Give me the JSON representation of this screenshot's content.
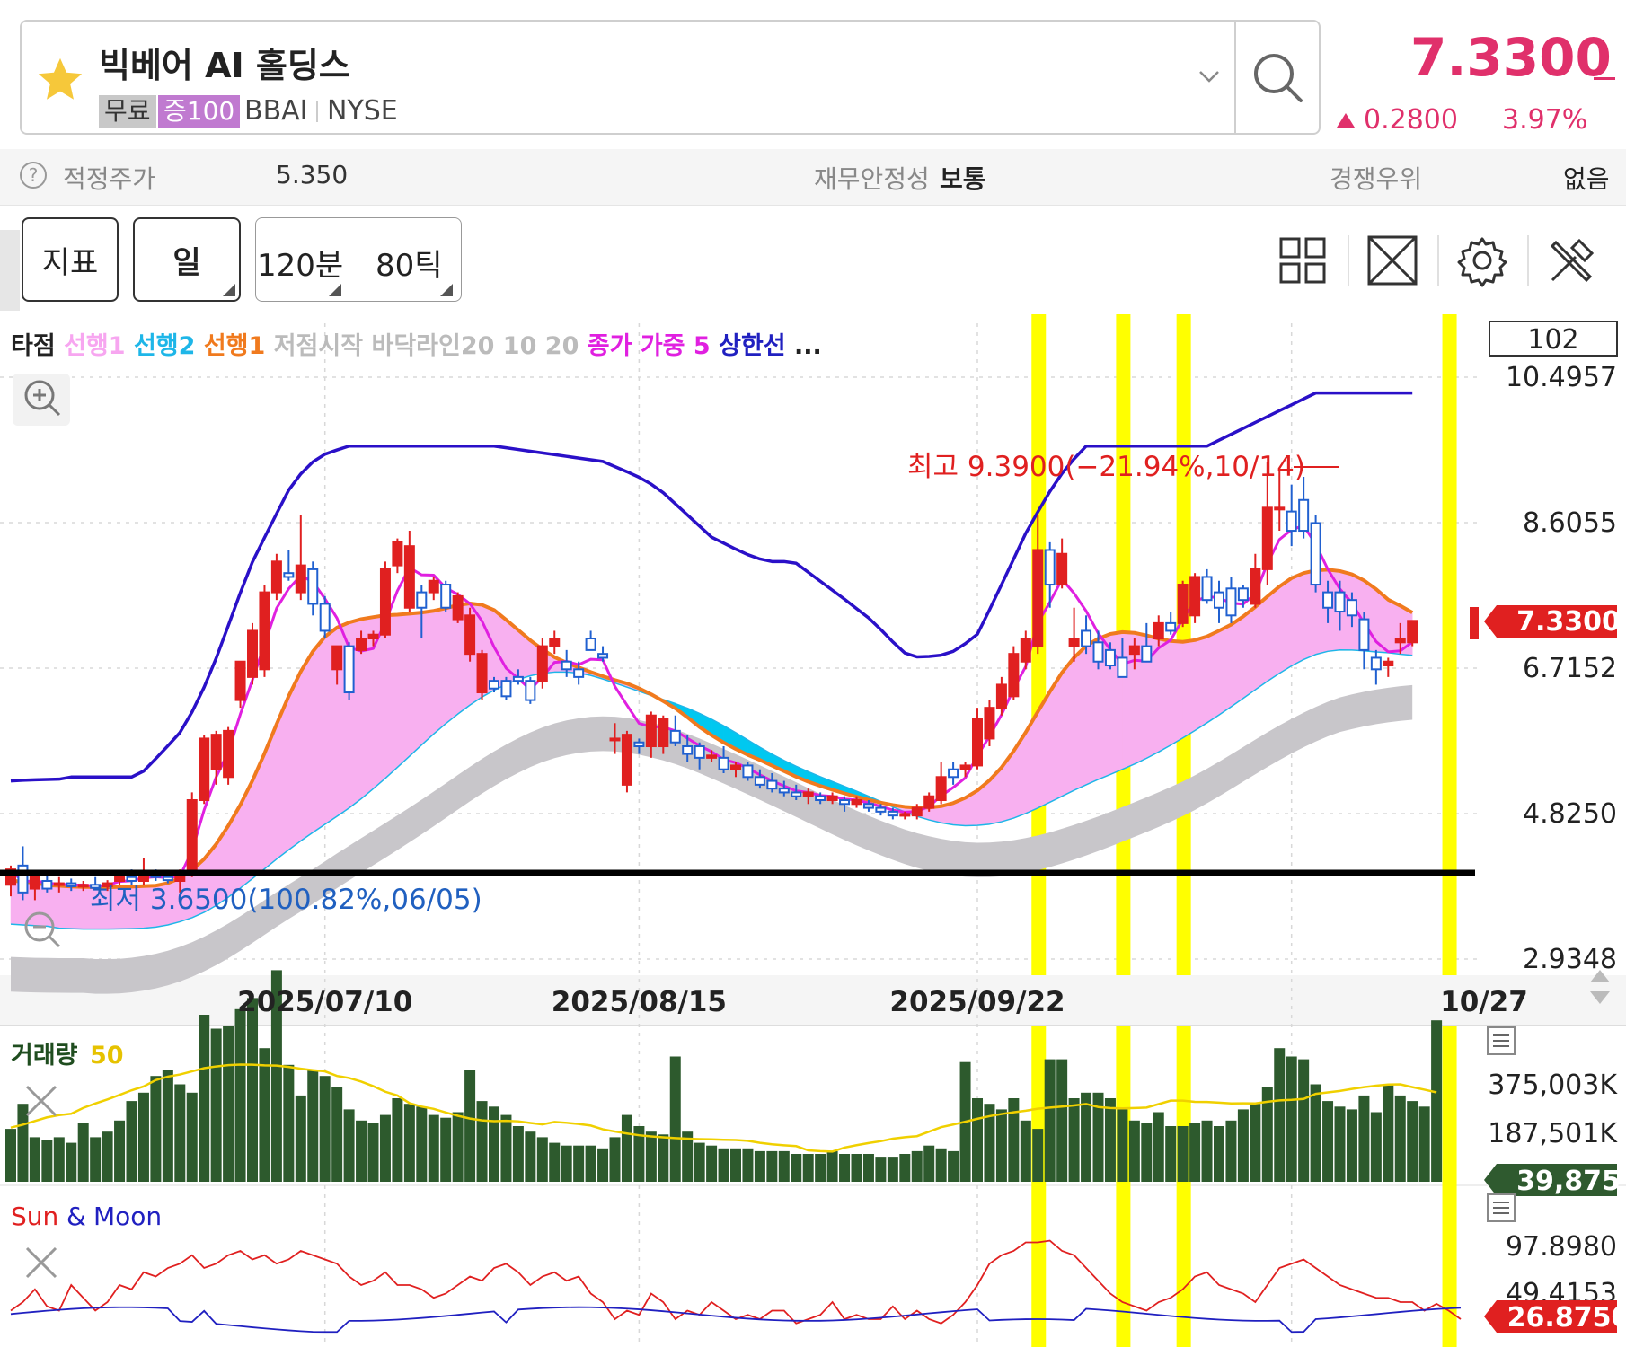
{
  "header": {
    "stock_name": "빅베어 AI 홀딩스",
    "tag_free": "무료",
    "tag_margin": "증100",
    "ticker": "BBAI",
    "exchange": "NYSE",
    "price": "7.3300",
    "change": "0.2800",
    "change_pct": "3.97%",
    "up_color": "#e0306b"
  },
  "info_bar": {
    "fair_price_label": "적정주가",
    "fair_price_value": "5.350",
    "stability_label": "재무안정성",
    "stability_value": "보통",
    "competitive_label": "경쟁우위",
    "competitive_value": "없음"
  },
  "toolbar": {
    "indicator_label": "지표",
    "day_label": "일",
    "min120_label": "120분",
    "tick80_label": "80틱",
    "icons": [
      "layout-grid-icon",
      "fullscreen-icon",
      "settings-gear-icon",
      "tools-icon"
    ]
  },
  "legend": {
    "items": [
      {
        "text": "타점",
        "color": "#222222"
      },
      {
        "text": "선행1",
        "color": "#f7a6f0"
      },
      {
        "text": "선행2",
        "color": "#1eb6e8"
      },
      {
        "text": "선행1",
        "color": "#f07a1e"
      },
      {
        "text": "저점시작",
        "color": "#bbbbbb"
      },
      {
        "text": "바닥라인20 10 20",
        "color": "#bbbbbb"
      },
      {
        "text": "종가 가중 5",
        "color": "#e020e0"
      },
      {
        "text": "상한선",
        "color": "#2020c0"
      },
      {
        "text": "...",
        "color": "#222222"
      }
    ],
    "period_box": "102"
  },
  "chart_data": {
    "type": "candlestick",
    "y_ticks": [
      "10.4957",
      "8.6055",
      "6.7152",
      "4.8250",
      "2.9348"
    ],
    "ylim": [
      2.9348,
      10.4957
    ],
    "x_ticks": [
      "2025/07/10",
      "2025/08/15",
      "2025/09/22",
      "10/27"
    ],
    "current_price_label": "7.3300",
    "high_annotation": "최고 9.3900(−21.94%,10/14)",
    "low_annotation": "최저 3.6500(100.82%,06/05)",
    "candles": [
      {
        "o": 3.9,
        "h": 4.15,
        "l": 3.75,
        "c": 4.1
      },
      {
        "o": 4.15,
        "h": 4.4,
        "l": 3.7,
        "c": 3.8
      },
      {
        "o": 3.85,
        "h": 4.05,
        "l": 3.7,
        "c": 4.0
      },
      {
        "o": 3.95,
        "h": 4.05,
        "l": 3.8,
        "c": 3.85
      },
      {
        "o": 3.9,
        "h": 4.0,
        "l": 3.8,
        "c": 3.92
      },
      {
        "o": 3.92,
        "h": 3.98,
        "l": 3.82,
        "c": 3.88
      },
      {
        "o": 3.88,
        "h": 3.95,
        "l": 3.82,
        "c": 3.9
      },
      {
        "o": 3.9,
        "h": 4.0,
        "l": 3.84,
        "c": 3.86
      },
      {
        "o": 3.88,
        "h": 3.96,
        "l": 3.82,
        "c": 3.92
      },
      {
        "o": 3.95,
        "h": 4.08,
        "l": 3.9,
        "c": 4.04
      },
      {
        "o": 4.0,
        "h": 4.1,
        "l": 3.9,
        "c": 3.95
      },
      {
        "o": 3.95,
        "h": 4.25,
        "l": 3.9,
        "c": 4.05
      },
      {
        "o": 4.05,
        "h": 4.1,
        "l": 3.95,
        "c": 4.0
      },
      {
        "o": 4.0,
        "h": 4.05,
        "l": 3.92,
        "c": 3.96
      },
      {
        "o": 3.95,
        "h": 4.1,
        "l": 3.8,
        "c": 4.05
      },
      {
        "o": 4.05,
        "h": 5.1,
        "l": 4.0,
        "c": 5.0
      },
      {
        "o": 5.0,
        "h": 5.85,
        "l": 4.95,
        "c": 5.8
      },
      {
        "o": 5.4,
        "h": 5.9,
        "l": 5.2,
        "c": 5.85
      },
      {
        "o": 5.3,
        "h": 5.95,
        "l": 5.2,
        "c": 5.9
      },
      {
        "o": 6.3,
        "h": 6.8,
        "l": 6.2,
        "c": 6.8
      },
      {
        "o": 6.6,
        "h": 7.3,
        "l": 6.5,
        "c": 7.2
      },
      {
        "o": 6.7,
        "h": 7.8,
        "l": 6.6,
        "c": 7.7
      },
      {
        "o": 7.7,
        "h": 8.2,
        "l": 7.6,
        "c": 8.1
      },
      {
        "o": 7.95,
        "h": 8.25,
        "l": 7.85,
        "c": 7.9
      },
      {
        "o": 7.7,
        "h": 8.7,
        "l": 7.6,
        "c": 8.05
      },
      {
        "o": 8.0,
        "h": 8.1,
        "l": 7.4,
        "c": 7.55
      },
      {
        "o": 7.55,
        "h": 7.65,
        "l": 7.1,
        "c": 7.2
      },
      {
        "o": 6.7,
        "h": 7.0,
        "l": 6.5,
        "c": 7.0
      },
      {
        "o": 7.0,
        "h": 7.05,
        "l": 6.3,
        "c": 6.4
      },
      {
        "o": 6.95,
        "h": 7.2,
        "l": 6.9,
        "c": 7.1
      },
      {
        "o": 7.1,
        "h": 7.2,
        "l": 7.0,
        "c": 7.15
      },
      {
        "o": 7.15,
        "h": 8.1,
        "l": 7.1,
        "c": 8.0
      },
      {
        "o": 8.05,
        "h": 8.4,
        "l": 7.95,
        "c": 8.35
      },
      {
        "o": 7.5,
        "h": 8.5,
        "l": 7.45,
        "c": 8.3
      },
      {
        "o": 7.7,
        "h": 7.8,
        "l": 7.1,
        "c": 7.5
      },
      {
        "o": 7.7,
        "h": 7.9,
        "l": 7.6,
        "c": 7.85
      },
      {
        "o": 7.8,
        "h": 7.85,
        "l": 7.45,
        "c": 7.5
      },
      {
        "o": 7.35,
        "h": 7.7,
        "l": 7.3,
        "c": 7.65
      },
      {
        "o": 6.9,
        "h": 7.5,
        "l": 6.8,
        "c": 7.4
      },
      {
        "o": 6.4,
        "h": 6.95,
        "l": 6.3,
        "c": 6.9
      },
      {
        "o": 6.55,
        "h": 6.6,
        "l": 6.4,
        "c": 6.45
      },
      {
        "o": 6.55,
        "h": 6.6,
        "l": 6.3,
        "c": 6.35
      },
      {
        "o": 6.6,
        "h": 6.7,
        "l": 6.5,
        "c": 6.55
      },
      {
        "o": 6.55,
        "h": 6.6,
        "l": 6.25,
        "c": 6.3
      },
      {
        "o": 6.55,
        "h": 7.1,
        "l": 6.45,
        "c": 7.0
      },
      {
        "o": 7.0,
        "h": 7.2,
        "l": 6.9,
        "c": 7.1
      },
      {
        "o": 6.8,
        "h": 6.95,
        "l": 6.6,
        "c": 6.7
      },
      {
        "o": 6.7,
        "h": 6.8,
        "l": 6.5,
        "c": 6.6
      },
      {
        "o": 7.1,
        "h": 7.2,
        "l": 6.95,
        "c": 6.95
      },
      {
        "o": 6.9,
        "h": 7.0,
        "l": 6.8,
        "c": 6.85
      },
      {
        "o": 5.8,
        "h": 6.0,
        "l": 5.6,
        "c": 5.8
      },
      {
        "o": 5.2,
        "h": 5.9,
        "l": 5.1,
        "c": 5.85
      },
      {
        "o": 5.75,
        "h": 5.8,
        "l": 5.6,
        "c": 5.7
      },
      {
        "o": 5.7,
        "h": 6.15,
        "l": 5.55,
        "c": 6.1
      },
      {
        "o": 5.7,
        "h": 6.1,
        "l": 5.6,
        "c": 6.05
      },
      {
        "o": 5.9,
        "h": 6.1,
        "l": 5.7,
        "c": 5.75
      },
      {
        "o": 5.7,
        "h": 5.85,
        "l": 5.5,
        "c": 5.6
      },
      {
        "o": 5.7,
        "h": 5.75,
        "l": 5.4,
        "c": 5.55
      },
      {
        "o": 5.55,
        "h": 5.65,
        "l": 5.5,
        "c": 5.58
      },
      {
        "o": 5.55,
        "h": 5.7,
        "l": 5.35,
        "c": 5.4
      },
      {
        "o": 5.4,
        "h": 5.5,
        "l": 5.3,
        "c": 5.45
      },
      {
        "o": 5.45,
        "h": 5.5,
        "l": 5.25,
        "c": 5.3
      },
      {
        "o": 5.3,
        "h": 5.4,
        "l": 5.15,
        "c": 5.2
      },
      {
        "o": 5.25,
        "h": 5.35,
        "l": 5.1,
        "c": 5.15
      },
      {
        "o": 5.15,
        "h": 5.25,
        "l": 5.05,
        "c": 5.1
      },
      {
        "o": 5.1,
        "h": 5.2,
        "l": 5.0,
        "c": 5.05
      },
      {
        "o": 5.05,
        "h": 5.15,
        "l": 4.95,
        "c": 5.1
      },
      {
        "o": 5.05,
        "h": 5.1,
        "l": 4.95,
        "c": 5.0
      },
      {
        "o": 5.0,
        "h": 5.1,
        "l": 4.95,
        "c": 5.05
      },
      {
        "o": 5.0,
        "h": 5.05,
        "l": 4.85,
        "c": 4.95
      },
      {
        "o": 4.95,
        "h": 5.05,
        "l": 4.9,
        "c": 5.0
      },
      {
        "o": 4.95,
        "h": 5.0,
        "l": 4.85,
        "c": 4.9
      },
      {
        "o": 4.9,
        "h": 4.95,
        "l": 4.8,
        "c": 4.85
      },
      {
        "o": 4.85,
        "h": 4.9,
        "l": 4.75,
        "c": 4.8
      },
      {
        "o": 4.8,
        "h": 4.85,
        "l": 4.75,
        "c": 4.82
      },
      {
        "o": 4.8,
        "h": 4.95,
        "l": 4.75,
        "c": 4.9
      },
      {
        "o": 4.9,
        "h": 5.1,
        "l": 4.85,
        "c": 5.05
      },
      {
        "o": 5.0,
        "h": 5.5,
        "l": 4.95,
        "c": 5.3
      },
      {
        "o": 5.4,
        "h": 5.5,
        "l": 5.2,
        "c": 5.3
      },
      {
        "o": 5.4,
        "h": 5.5,
        "l": 5.3,
        "c": 5.45
      },
      {
        "o": 5.45,
        "h": 6.2,
        "l": 5.4,
        "c": 6.05
      },
      {
        "o": 5.8,
        "h": 6.3,
        "l": 5.7,
        "c": 6.2
      },
      {
        "o": 6.2,
        "h": 6.6,
        "l": 6.1,
        "c": 6.5
      },
      {
        "o": 6.35,
        "h": 7.0,
        "l": 6.3,
        "c": 6.9
      },
      {
        "o": 6.8,
        "h": 7.2,
        "l": 6.7,
        "c": 7.1
      },
      {
        "o": 7.0,
        "h": 8.7,
        "l": 6.9,
        "c": 8.25
      },
      {
        "o": 8.25,
        "h": 8.35,
        "l": 7.5,
        "c": 7.8
      },
      {
        "o": 7.8,
        "h": 8.4,
        "l": 7.75,
        "c": 8.2
      },
      {
        "o": 7.0,
        "h": 7.5,
        "l": 6.8,
        "c": 7.1
      },
      {
        "o": 7.2,
        "h": 7.4,
        "l": 6.9,
        "c": 7.0
      },
      {
        "o": 7.05,
        "h": 7.2,
        "l": 6.7,
        "c": 6.8
      },
      {
        "o": 6.95,
        "h": 7.05,
        "l": 6.7,
        "c": 6.75
      },
      {
        "o": 6.85,
        "h": 7.1,
        "l": 6.6,
        "c": 6.6
      },
      {
        "o": 6.9,
        "h": 7.1,
        "l": 6.7,
        "c": 7.0
      },
      {
        "o": 7.0,
        "h": 7.3,
        "l": 6.8,
        "c": 6.8
      },
      {
        "o": 7.1,
        "h": 7.4,
        "l": 7.0,
        "c": 7.3
      },
      {
        "o": 7.3,
        "h": 7.45,
        "l": 7.15,
        "c": 7.2
      },
      {
        "o": 7.3,
        "h": 7.85,
        "l": 7.25,
        "c": 7.8
      },
      {
        "o": 7.4,
        "h": 7.95,
        "l": 7.3,
        "c": 7.9
      },
      {
        "o": 7.9,
        "h": 8.0,
        "l": 7.55,
        "c": 7.6
      },
      {
        "o": 7.7,
        "h": 7.85,
        "l": 7.3,
        "c": 7.5
      },
      {
        "o": 7.75,
        "h": 7.9,
        "l": 7.3,
        "c": 7.4
      },
      {
        "o": 7.75,
        "h": 7.8,
        "l": 7.5,
        "c": 7.6
      },
      {
        "o": 7.55,
        "h": 8.2,
        "l": 7.5,
        "c": 8.0
      },
      {
        "o": 8.0,
        "h": 9.39,
        "l": 7.8,
        "c": 8.8
      },
      {
        "o": 8.8,
        "h": 9.3,
        "l": 8.5,
        "c": 8.8
      },
      {
        "o": 8.75,
        "h": 9.1,
        "l": 8.3,
        "c": 8.5
      },
      {
        "o": 8.9,
        "h": 9.2,
        "l": 8.4,
        "c": 8.5
      },
      {
        "o": 8.6,
        "h": 8.7,
        "l": 7.7,
        "c": 7.8
      },
      {
        "o": 7.7,
        "h": 7.85,
        "l": 7.3,
        "c": 7.5
      },
      {
        "o": 7.7,
        "h": 7.85,
        "l": 7.2,
        "c": 7.45
      },
      {
        "o": 7.6,
        "h": 7.7,
        "l": 7.25,
        "c": 7.4
      },
      {
        "o": 7.35,
        "h": 7.45,
        "l": 6.7,
        "c": 6.95
      },
      {
        "o": 6.85,
        "h": 6.95,
        "l": 6.5,
        "c": 6.7
      },
      {
        "o": 6.75,
        "h": 6.85,
        "l": 6.6,
        "c": 6.8
      },
      {
        "o": 7.05,
        "h": 7.3,
        "l": 6.9,
        "c": 7.1
      },
      {
        "o": 7.05,
        "h": 7.3,
        "l": 7.0,
        "c": 7.33
      }
    ],
    "highlight_bands_index": [
      85,
      92,
      97,
      119
    ],
    "volume": {
      "label": "거래량",
      "ma_label": "50",
      "ticks": [
        "375,003K",
        "187,501K"
      ],
      "current_label": "39,875",
      "values": [
        95,
        140,
        80,
        75,
        80,
        70,
        105,
        80,
        90,
        110,
        145,
        160,
        190,
        200,
        175,
        160,
        300,
        275,
        280,
        310,
        330,
        240,
        380,
        210,
        155,
        200,
        190,
        170,
        130,
        110,
        105,
        120,
        150,
        140,
        135,
        120,
        115,
        125,
        200,
        145,
        135,
        120,
        100,
        90,
        80,
        70,
        65,
        65,
        65,
        60,
        80,
        120,
        100,
        90,
        85,
        225,
        90,
        70,
        65,
        60,
        60,
        60,
        55,
        55,
        55,
        50,
        50,
        50,
        55,
        50,
        50,
        50,
        45,
        45,
        50,
        55,
        65,
        60,
        55,
        215,
        150,
        140,
        130,
        150,
        110,
        95,
        220,
        220,
        150,
        160,
        160,
        150,
        130,
        110,
        105,
        125,
        100,
        100,
        105,
        110,
        100,
        110,
        130,
        140,
        170,
        240,
        225,
        220,
        175,
        145,
        135,
        130,
        155,
        125,
        175,
        155,
        145,
        135,
        290
      ]
    },
    "sun_moon": {
      "label_sun": "Sun",
      "label_amp": "&",
      "label_moon": "Moon",
      "ticks": [
        "97.8980",
        "49.4153"
      ],
      "current_label": "26.8750",
      "sun_values": [
        30,
        40,
        55,
        35,
        30,
        60,
        45,
        30,
        40,
        60,
        55,
        75,
        70,
        80,
        85,
        95,
        80,
        85,
        95,
        100,
        90,
        95,
        85,
        90,
        100,
        95,
        90,
        85,
        70,
        60,
        65,
        75,
        60,
        60,
        55,
        45,
        50,
        60,
        70,
        65,
        80,
        85,
        75,
        60,
        70,
        75,
        65,
        70,
        50,
        40,
        20,
        30,
        25,
        50,
        40,
        20,
        30,
        25,
        40,
        30,
        20,
        25,
        20,
        30,
        30,
        15,
        20,
        25,
        40,
        20,
        25,
        20,
        20,
        35,
        20,
        30,
        20,
        15,
        25,
        40,
        60,
        85,
        95,
        100,
        110,
        110,
        112,
        100,
        95,
        80,
        65,
        50,
        40,
        35,
        30,
        40,
        45,
        55,
        70,
        75,
        60,
        55,
        50,
        40,
        60,
        80,
        85,
        90,
        80,
        70,
        60,
        55,
        50,
        45,
        45,
        40,
        40,
        30,
        38,
        30,
        20
      ]
    }
  }
}
